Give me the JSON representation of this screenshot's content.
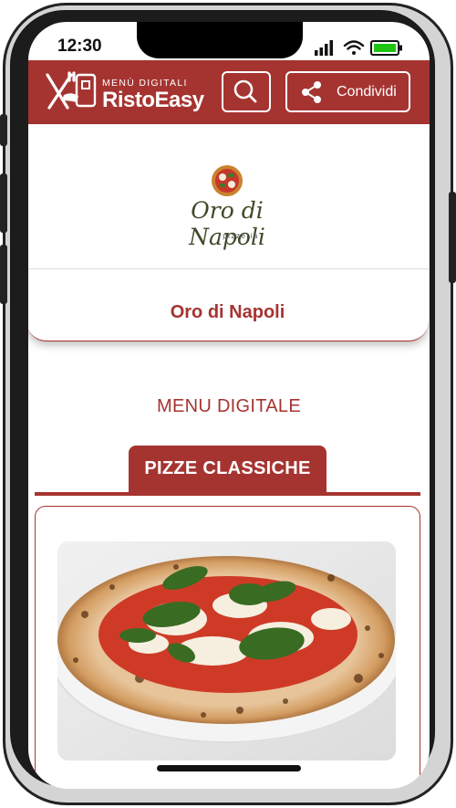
{
  "status_bar": {
    "time": "12:30"
  },
  "brand": {
    "tagline": "MENÙ DIGITALI",
    "name": "RistoEasy",
    "accent_color": "#a53431",
    "logo_icon": "fork-knife-phone-icon"
  },
  "toolbar": {
    "search_icon": "search-icon",
    "share_label": "Condividi",
    "share_icon": "share-icon"
  },
  "restaurant": {
    "logo_script": "Oro di Napoli",
    "logo_sub": "pizzeria",
    "name": "Oro di Napoli"
  },
  "menu": {
    "heading": "MENU DIGITALE",
    "active_category": "PIZZE CLASSICHE",
    "items": [
      {
        "image": "pizza-margherita-photo"
      }
    ]
  }
}
